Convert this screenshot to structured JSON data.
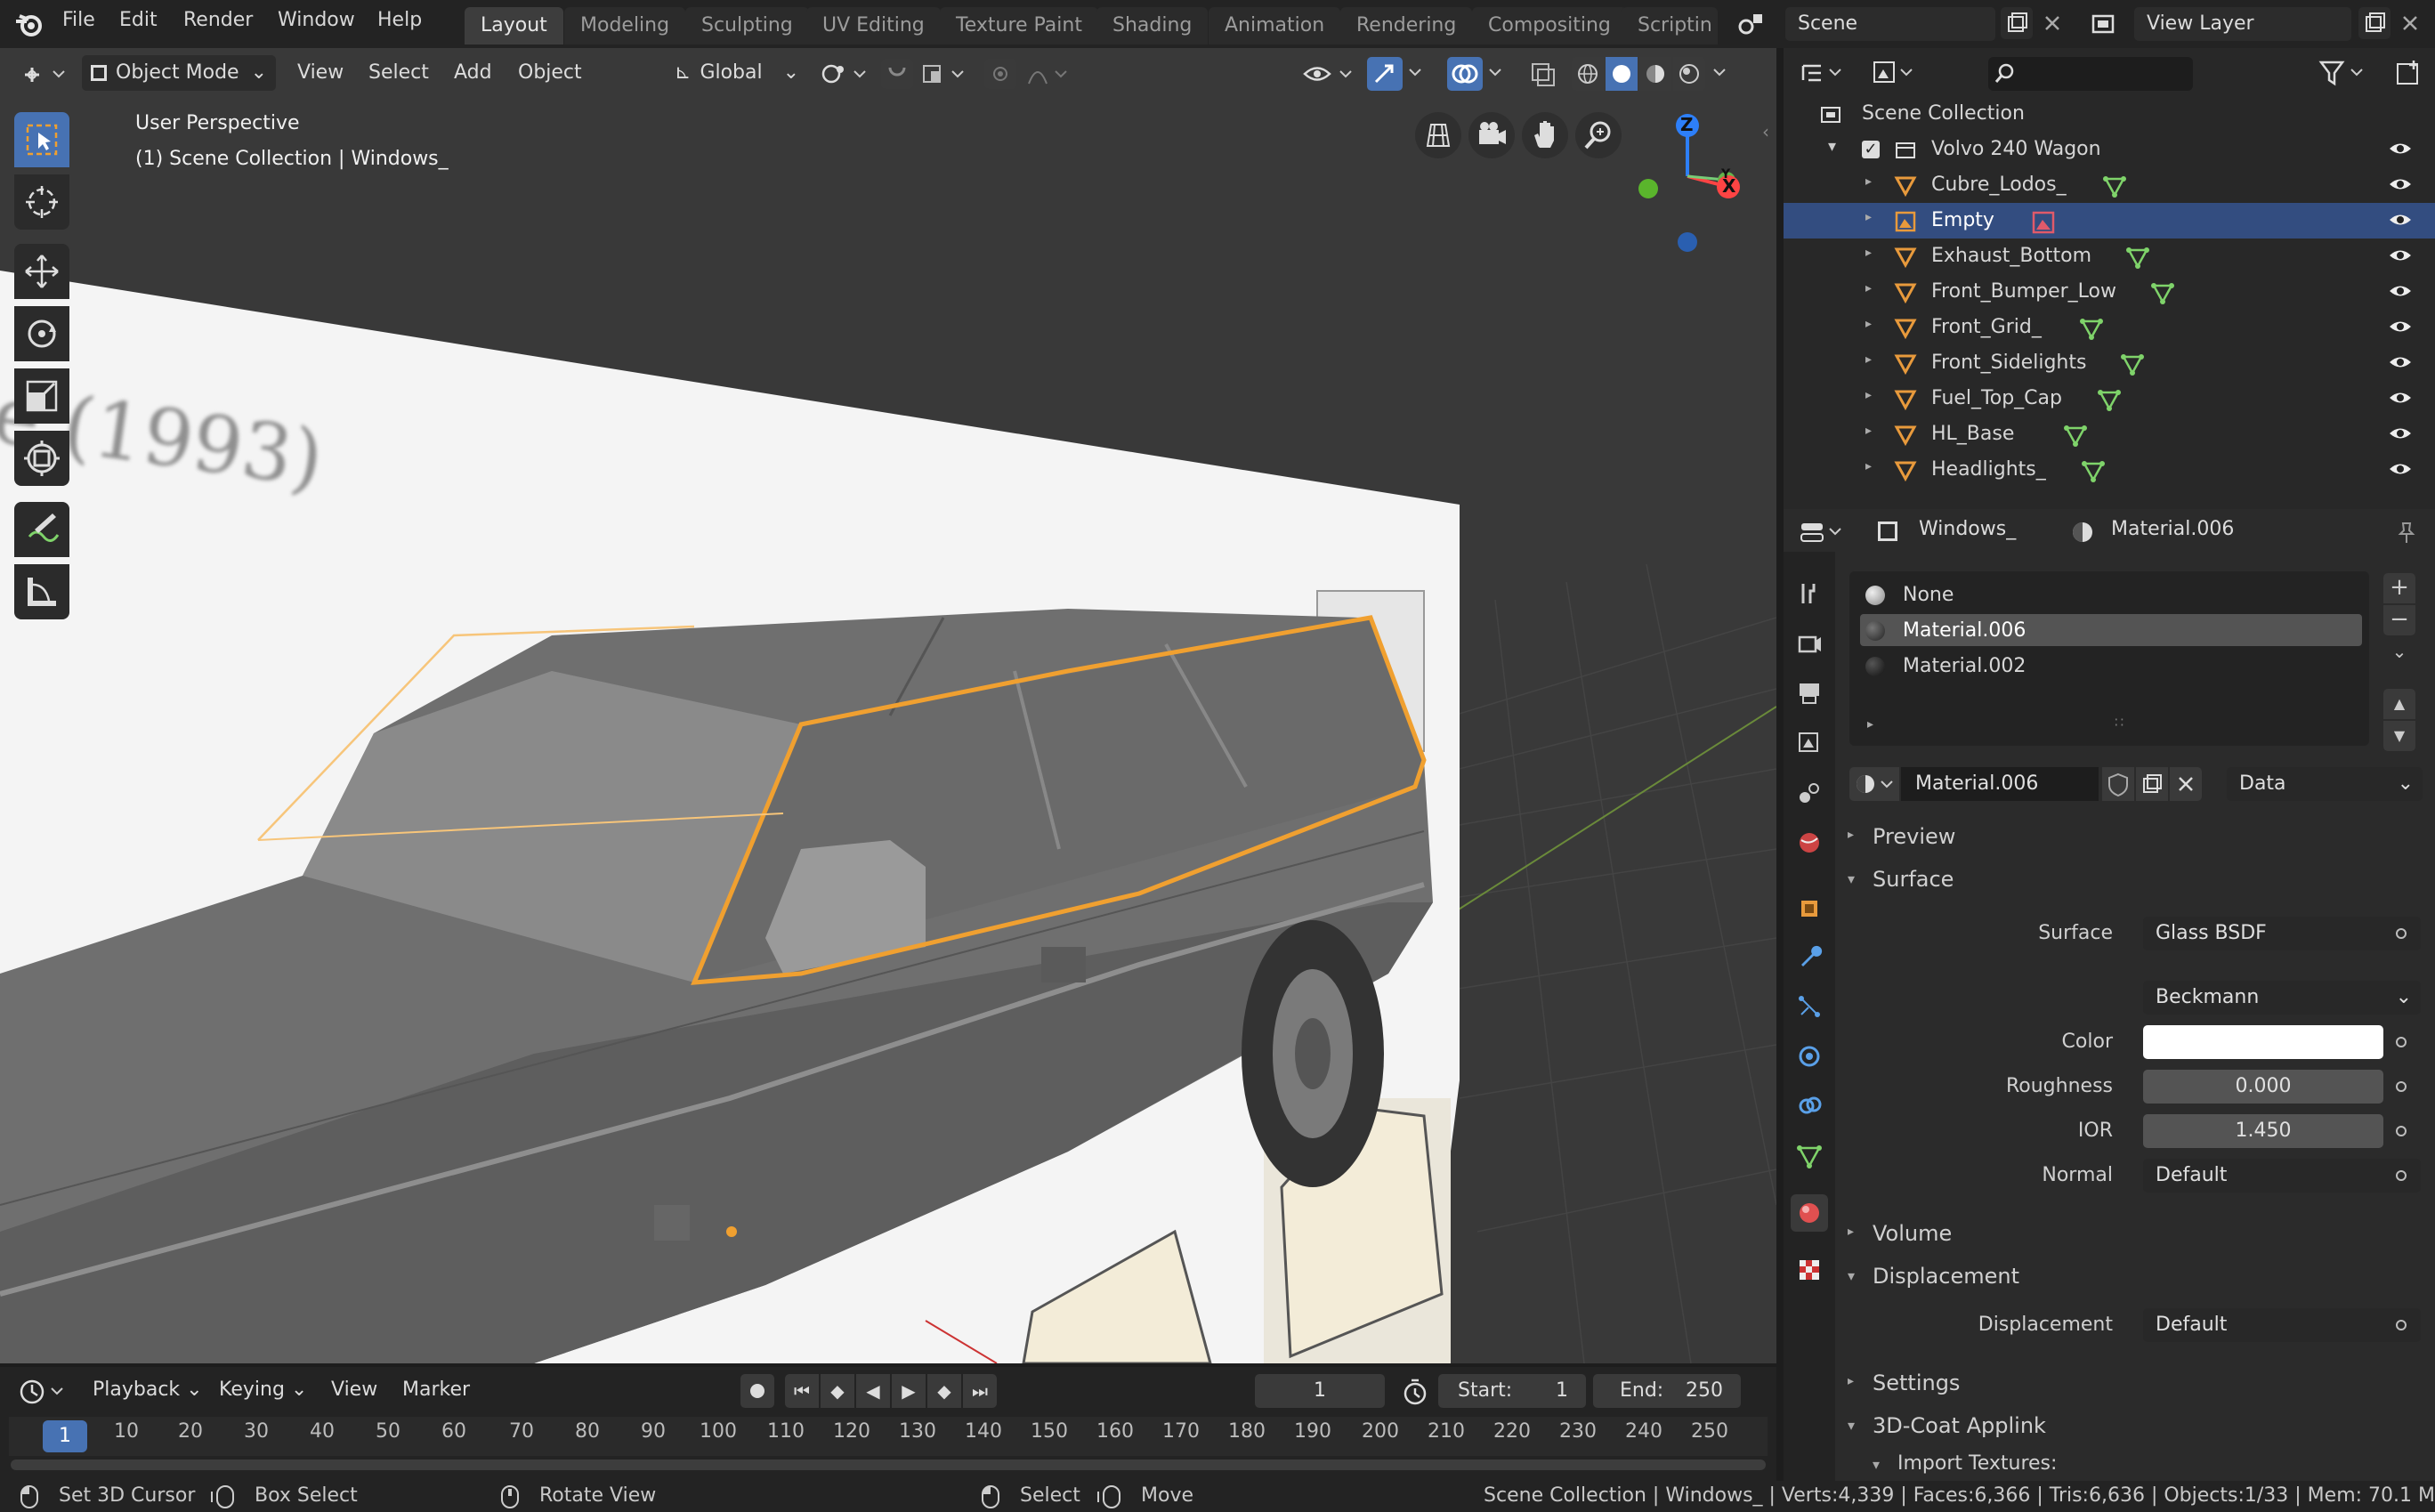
{
  "menu": [
    "File",
    "Edit",
    "Render",
    "Window",
    "Help"
  ],
  "workspaces": [
    "Layout",
    "Modeling",
    "Sculpting",
    "UV Editing",
    "Texture Paint",
    "Shading",
    "Animation",
    "Rendering",
    "Compositing",
    "Scriptin"
  ],
  "scene": {
    "name": "Scene",
    "view_layer": "View Layer"
  },
  "viewport": {
    "mode": "Object Mode",
    "menus": [
      "View",
      "Select",
      "Add",
      "Object"
    ],
    "orientation": "Global",
    "perspective": "User Perspective",
    "context": "(1) Scene Collection | Windows_",
    "overlay_text": "e (1993)",
    "gizmo": {
      "z": "Z",
      "y": "Y",
      "x": "X"
    }
  },
  "outliner": {
    "root": "Scene Collection",
    "collection": "Volvo 240 Wagon",
    "items": [
      "Cubre_Lodos_",
      "Empty",
      "Exhaust_Bottom",
      "Front_Bumper_Low",
      "Front_Grid_",
      "Front_Sidelights",
      "Fuel_Top_Cap",
      "HL_Base",
      "Headlights_"
    ]
  },
  "properties": {
    "object": "Windows_",
    "material": "Material.006",
    "slots": [
      "None",
      "Material.006",
      "Material.002"
    ],
    "active_material": "Material.006",
    "link": "Data",
    "sections": {
      "preview": "Preview",
      "surface": "Surface",
      "volume": "Volume",
      "displacement": "Displacement",
      "settings": "Settings",
      "coat": "3D-Coat Applink",
      "import": "Import Textures:"
    },
    "surface_label": "Surface",
    "surface_value": "Glass BSDF",
    "distribution": "Beckmann",
    "color_label": "Color",
    "roughness_label": "Roughness",
    "roughness": "0.000",
    "ior_label": "IOR",
    "ior": "1.450",
    "normal_label": "Normal",
    "normal": "Default",
    "displacement_label": "Displacement",
    "displacement": "Default"
  },
  "timeline": {
    "menus": [
      "Playback",
      "Keying",
      "View",
      "Marker"
    ],
    "current": "1",
    "start_label": "Start:",
    "start": "1",
    "end_label": "End:",
    "end": "250",
    "frames": [
      "10",
      "20",
      "30",
      "40",
      "50",
      "60",
      "70",
      "80",
      "90",
      "100",
      "110",
      "120",
      "130",
      "140",
      "150",
      "160",
      "170",
      "180",
      "190",
      "200",
      "210",
      "220",
      "230",
      "240",
      "250"
    ]
  },
  "status": {
    "left": [
      "Set 3D Cursor",
      "Box Select",
      "Rotate View",
      "Select",
      "Move"
    ],
    "right": "Scene Collection | Windows_ | Verts:4,339 | Faces:6,366 | Tris:6,636 | Objects:1/33 | Mem: 70.1 M"
  },
  "colors": {
    "accent": "#4772b3",
    "selection": "#334d80",
    "outline": "#f0a030",
    "mesh_icon": "#e89a3c",
    "data_icon": "#7fd36a"
  }
}
